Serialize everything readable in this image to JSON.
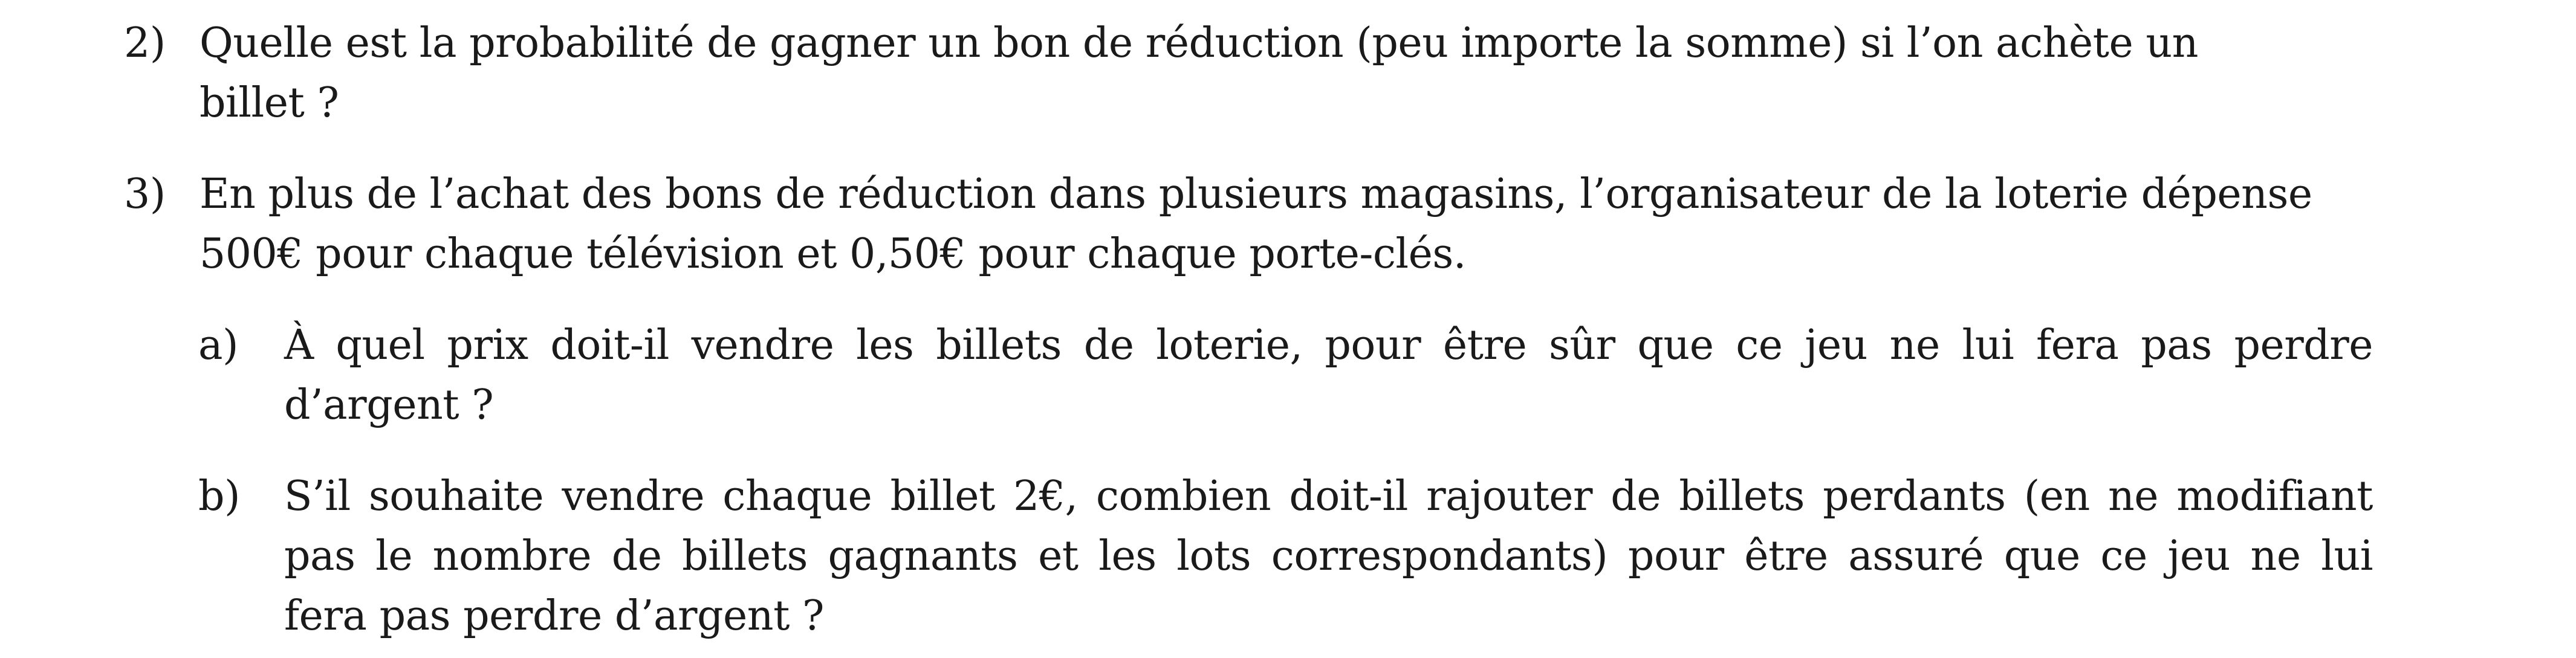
{
  "questions": [
    {
      "number": "2)",
      "lines": [
        "Quelle est la probabilité de gagner un bon de réduction (peu importe la somme) si l’on achète un",
        "billet ?"
      ]
    },
    {
      "number": "3)",
      "lines": [
        "En plus de l’achat des bons de réduction dans plusieurs magasins, l’organisateur de la loterie dépense",
        "500€ pour chaque télévision et 0,50€ pour chaque porte-clés."
      ],
      "subquestions": [
        {
          "letter": "a)",
          "lines": [
            "À quel prix doit-il vendre les billets de loterie, pour être sûr que ce jeu ne lui fera pas perdre",
            "d’argent ?"
          ]
        },
        {
          "letter": "b)",
          "lines": [
            "S’il souhaite vendre chaque billet 2€, combien doit-il rajouter de billets perdants (en ne modifiant",
            "pas le nombre de billets gagnants et les lots correspondants) pour être assuré que ce jeu ne lui",
            "fera pas perdre d’argent ?"
          ]
        }
      ]
    }
  ]
}
